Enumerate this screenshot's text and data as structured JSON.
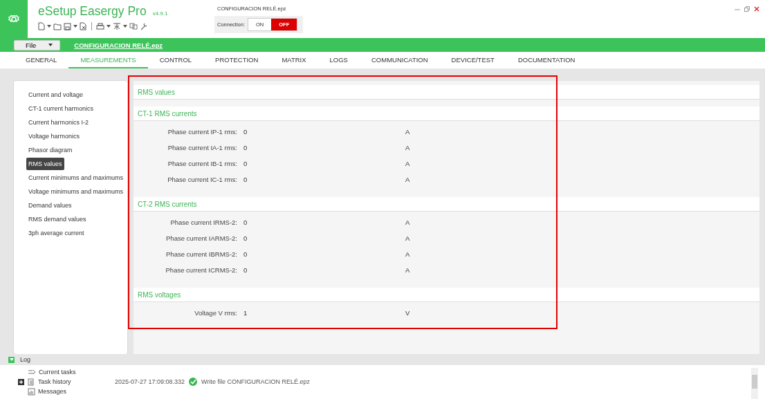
{
  "app": {
    "title": "eSetup Easergy Pro",
    "version": "v4.9.1",
    "file_name": "CONFIGURACION RELÉ.epz"
  },
  "connection": {
    "label": "Connection:",
    "options": [
      {
        "label": "ON",
        "selected": false
      },
      {
        "label": "OFF",
        "selected": true
      }
    ]
  },
  "file_bar": {
    "menu": "File",
    "file_link": "CONFIGURACION RELÉ.epz"
  },
  "tabs": [
    {
      "label": "GENERAL",
      "selected": false
    },
    {
      "label": "MEASUREMENTS",
      "selected": true
    },
    {
      "label": "CONTROL",
      "selected": false
    },
    {
      "label": "PROTECTION",
      "selected": false
    },
    {
      "label": "MATRIX",
      "selected": false
    },
    {
      "label": "LOGS",
      "selected": false
    },
    {
      "label": "COMMUNICATION",
      "selected": false
    },
    {
      "label": "DEVICE/TEST",
      "selected": false
    },
    {
      "label": "DOCUMENTATION",
      "selected": false
    }
  ],
  "sidebar": {
    "items": [
      {
        "label": "Current and voltage",
        "selected": false
      },
      {
        "label": "CT-1 current harmonics",
        "selected": false
      },
      {
        "label": "Current harmonics I-2",
        "selected": false
      },
      {
        "label": "Voltage harmonics",
        "selected": false
      },
      {
        "label": "Phasor diagram",
        "selected": false
      },
      {
        "label": "RMS values",
        "selected": true
      },
      {
        "label": "Current minimums and maximums",
        "selected": false
      },
      {
        "label": "Voltage minimums and maximums",
        "selected": false
      },
      {
        "label": "Demand values",
        "selected": false
      },
      {
        "label": "RMS demand values",
        "selected": false
      },
      {
        "label": "3ph average current",
        "selected": false
      }
    ]
  },
  "page_title": "RMS values",
  "sections": [
    {
      "title": "CT-1 RMS currents",
      "rows": [
        {
          "label": "Phase current IP-1 rms:",
          "value": "0",
          "unit": "A"
        },
        {
          "label": "Phase current IA-1 rms:",
          "value": "0",
          "unit": "A"
        },
        {
          "label": "Phase current IB-1 rms:",
          "value": "0",
          "unit": "A"
        },
        {
          "label": "Phase current IC-1 rms:",
          "value": "0",
          "unit": "A"
        }
      ]
    },
    {
      "title": "CT-2 RMS currents",
      "rows": [
        {
          "label": "Phase current IRMS-2:",
          "value": "0",
          "unit": "A"
        },
        {
          "label": "Phase current IARMS-2:",
          "value": "0",
          "unit": "A"
        },
        {
          "label": "Phase current IBRMS-2:",
          "value": "0",
          "unit": "A"
        },
        {
          "label": "Phase current ICRMS-2:",
          "value": "0",
          "unit": "A"
        }
      ]
    },
    {
      "title": "RMS voltages",
      "rows": [
        {
          "label": "Voltage V rms:",
          "value": "1",
          "unit": "V"
        }
      ]
    }
  ],
  "log": {
    "title": "Log",
    "expanded": true,
    "tree": [
      {
        "label": "Current tasks",
        "kind": "tasks"
      },
      {
        "label": "Task history",
        "kind": "history",
        "expanded": false
      },
      {
        "label": "Messages",
        "kind": "messages"
      }
    ],
    "entries": [
      {
        "time": "2025-07-27 17:09:08.332",
        "success": true,
        "message": "Write file CONFIGURACION RELÉ.epz"
      }
    ]
  }
}
